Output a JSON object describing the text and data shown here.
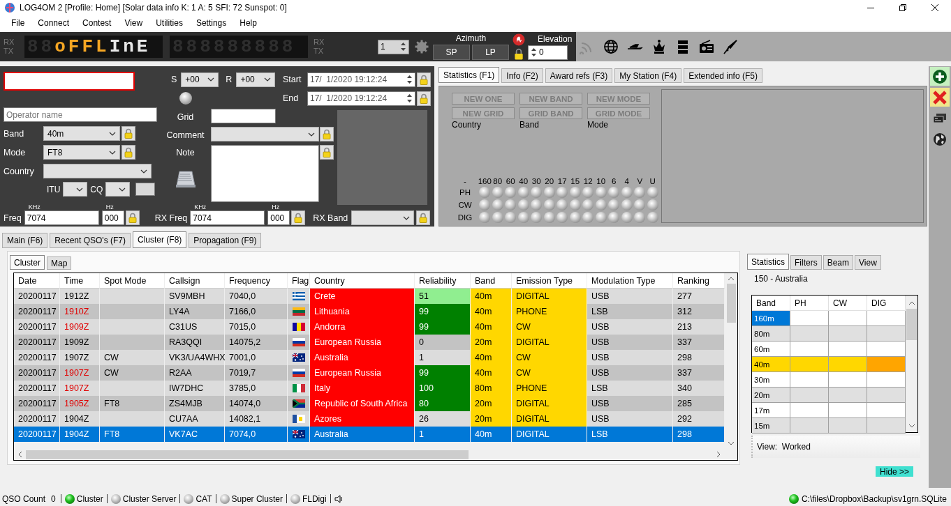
{
  "window": {
    "title": "LOG4OM 2 [Profile: Home] [Solar data info K: 1 A: 5 SFI: 72 Sunspot: 0]"
  },
  "menu": [
    "File",
    "Connect",
    "Contest",
    "View",
    "Utilities",
    "Settings",
    "Help"
  ],
  "toolbar": {
    "rx_tx_left": [
      "RX",
      "TX"
    ],
    "displays": [
      {
        "dim": "88",
        "segments": [
          {
            "text": "oFFL",
            "color": "#f5a623"
          },
          {
            "text": "InE",
            "color": "#e8e8e8"
          }
        ]
      },
      {
        "dim": "888888888"
      }
    ],
    "rx_tx_right": [
      "RX",
      "TX"
    ],
    "counter": "1",
    "azimuth": {
      "label": "Azimuth",
      "buttons": [
        "SP",
        "LP"
      ]
    },
    "elevation": {
      "label": "Elevation",
      "value": "0"
    }
  },
  "qso_form": {
    "callsign": {
      "highlighted": true
    },
    "operator": {
      "placeholder": "Operator name"
    },
    "band": {
      "label": "Band",
      "value": "40m"
    },
    "mode": {
      "label": "Mode",
      "value": "FT8"
    },
    "country": {
      "label": "Country"
    },
    "itu": {
      "label": "ITU"
    },
    "cq": {
      "label": "CQ"
    },
    "s": {
      "label": "S",
      "value": "+00"
    },
    "r": {
      "label": "R",
      "value": "+00"
    },
    "start": {
      "label": "Start",
      "value": "17/  1/2020 19:12:24"
    },
    "end": {
      "label": "End",
      "value": "17/  1/2020 19:12:24"
    },
    "grid": {
      "label": "Grid"
    },
    "comment": {
      "label": "Comment"
    },
    "note": {
      "label": "Note"
    },
    "freq": {
      "label": "Freq",
      "khz_label": "KHz",
      "khz": "7074",
      "hz_label": "Hz",
      "hz": "000"
    },
    "rx_freq": {
      "label": "RX Freq",
      "khz_label": "KHz",
      "khz": "7074",
      "hz_label": "Hz",
      "hz": "000"
    },
    "rx_band": {
      "label": "RX Band"
    }
  },
  "stats_panel": {
    "tabs": [
      {
        "label": "Statistics (F1)",
        "selected": true
      },
      {
        "label": "Info (F2)",
        "selected": false
      },
      {
        "label": "Award refs (F3)",
        "selected": false
      },
      {
        "label": "My Station (F4)",
        "selected": false
      },
      {
        "label": "Extended info (F5)",
        "selected": false
      }
    ],
    "flags": [
      {
        "label": "NEW ONE",
        "disabled": true
      },
      {
        "label": "NEW BAND",
        "disabled": true
      },
      {
        "label": "NEW MODE",
        "disabled": true
      },
      {
        "label": "NEW GRID",
        "disabled": true
      },
      {
        "label": "GRID BAND",
        "disabled": true
      },
      {
        "label": "GRID MODE",
        "disabled": true
      }
    ],
    "columns": [
      "Country",
      "Band",
      "Mode"
    ],
    "band_grid": {
      "corner": "-",
      "bands": [
        "160",
        "80",
        "60",
        "40",
        "30",
        "20",
        "17",
        "15",
        "12",
        "10",
        "6",
        "4",
        "V",
        "U"
      ],
      "modes": [
        "PH",
        "CW",
        "DIG"
      ]
    }
  },
  "main_tabs": [
    {
      "label": "Main (F6)",
      "selected": false
    },
    {
      "label": "Recent QSO's (F7)",
      "selected": false
    },
    {
      "label": "Cluster (F8)",
      "selected": true
    },
    {
      "label": "Propagation (F9)",
      "selected": false
    }
  ],
  "cluster": {
    "tabs": [
      {
        "label": "Cluster",
        "selected": true
      },
      {
        "label": "Map",
        "selected": false
      }
    ],
    "columns": [
      "Date",
      "Time",
      "Spot Mode",
      "Callsign",
      "Frequency",
      "Flag",
      "Country",
      "Reliability",
      "Band",
      "Emission Type",
      "Modulation Type",
      "Ranking"
    ],
    "rows": [
      {
        "date": "20200117",
        "time": "1912Z",
        "time_alert": false,
        "callsign": "SV9MBH",
        "frequency": "7040,0",
        "flag": {
          "kind": "greece"
        },
        "country": "Crete",
        "reliability": {
          "value": "51",
          "color": "#90ee90"
        },
        "band": "40m",
        "emission": "DIGITAL",
        "modulation": "USB",
        "ranking": "277",
        "selected": false
      },
      {
        "date": "20200117",
        "time": "1910Z",
        "time_alert": true,
        "callsign": "LY4A",
        "frequency": "7166,0",
        "flag": {
          "kind": "lithuania"
        },
        "country": "Lithuania",
        "reliability": {
          "value": "99",
          "color": "#008000"
        },
        "band": "40m",
        "emission": "PHONE",
        "modulation": "LSB",
        "ranking": "312",
        "selected": false
      },
      {
        "date": "20200117",
        "time": "1909Z",
        "time_alert": true,
        "callsign": "C31US",
        "frequency": "7015,0",
        "flag": {
          "kind": "andorra"
        },
        "country": "Andorra",
        "reliability": {
          "value": "99",
          "color": "#008000"
        },
        "band": "40m",
        "emission": "CW",
        "modulation": "USB",
        "ranking": "213",
        "selected": false
      },
      {
        "date": "20200117",
        "time": "1909Z",
        "time_alert": false,
        "callsign": "RA3QQI",
        "frequency": "14075,2",
        "flag": {
          "kind": "russia"
        },
        "country": "European Russia",
        "reliability": {
          "value": "0"
        },
        "band": "20m",
        "emission": "DIGITAL",
        "modulation": "USB",
        "ranking": "337",
        "selected": false
      },
      {
        "date": "20200117",
        "time": "1907Z",
        "time_alert": false,
        "spot_mode": "CW",
        "callsign": "VK3/UA4WHX",
        "frequency": "7001,0",
        "flag": {
          "kind": "australia"
        },
        "country": "Australia",
        "reliability": {
          "value": "1"
        },
        "band": "40m",
        "emission": "CW",
        "modulation": "USB",
        "ranking": "298",
        "selected": false
      },
      {
        "date": "20200117",
        "time": "1907Z",
        "time_alert": true,
        "spot_mode": "CW",
        "callsign": "R2AA",
        "frequency": "7019,7",
        "flag": {
          "kind": "russia"
        },
        "country": "European Russia",
        "reliability": {
          "value": "99",
          "color": "#008000"
        },
        "band": "40m",
        "emission": "CW",
        "modulation": "USB",
        "ranking": "337",
        "selected": false
      },
      {
        "date": "20200117",
        "time": "1907Z",
        "time_alert": true,
        "callsign": "IW7DHC",
        "frequency": "3785,0",
        "flag": {
          "kind": "italy"
        },
        "country": "Italy",
        "reliability": {
          "value": "100",
          "color": "#008000"
        },
        "band": "80m",
        "emission": "PHONE",
        "modulation": "LSB",
        "ranking": "340",
        "selected": false
      },
      {
        "date": "20200117",
        "time": "1905Z",
        "time_alert": true,
        "spot_mode": "FT8",
        "callsign": "ZS4MJB",
        "frequency": "14074,0",
        "flag": {
          "kind": "south-africa"
        },
        "country": "Republic of South Africa",
        "reliability": {
          "value": "80",
          "color": "#008000"
        },
        "band": "20m",
        "emission": "DIGITAL",
        "modulation": "USB",
        "ranking": "285",
        "selected": false
      },
      {
        "date": "20200117",
        "time": "1904Z",
        "time_alert": false,
        "callsign": "CU7AA",
        "frequency": "14082,1",
        "flag": {
          "kind": "azores"
        },
        "country": "Azores",
        "reliability": {
          "value": "26"
        },
        "band": "20m",
        "emission": "DIGITAL",
        "modulation": "USB",
        "ranking": "292",
        "selected": false
      },
      {
        "date": "20200117",
        "time": "1904Z",
        "spot_mode": "FT8",
        "callsign": "VK7AC",
        "frequency": "7074,0",
        "flag": {
          "kind": "australia"
        },
        "country": "Australia",
        "reliability": {
          "value": "1"
        },
        "band": "40m",
        "emission": "DIGITAL",
        "modulation": "LSB",
        "ranking": "298",
        "selected": true
      }
    ]
  },
  "band_stats": {
    "tabs": [
      {
        "label": "Statistics",
        "selected": true
      },
      {
        "label": "Filters",
        "selected": false
      },
      {
        "label": "Beam",
        "selected": false
      },
      {
        "label": "View",
        "selected": false
      }
    ],
    "entity": "150 - Australia",
    "columns": [
      "Band",
      "PH",
      "CW",
      "DIG"
    ],
    "rows": [
      {
        "band": "160m",
        "selected": true
      },
      {
        "band": "80m",
        "selected": false
      },
      {
        "band": "60m",
        "selected": false
      },
      {
        "band": "40m",
        "selected": false,
        "color": "#ffd700",
        "cells": [
          {
            "color": "#ffd700"
          },
          {
            "color": "#ffd700"
          },
          {
            "color": "#ffa500"
          }
        ]
      },
      {
        "band": "30m",
        "selected": false
      },
      {
        "band": "20m",
        "selected": false
      },
      {
        "band": "17m",
        "selected": false
      },
      {
        "band": "15m",
        "selected": false
      }
    ],
    "view": "View:  Worked",
    "hide_button": "Hide >>"
  },
  "status_bar": {
    "qso_label": "QSO Count",
    "qso_count": "0",
    "items": [
      {
        "label": "Cluster",
        "on": true
      },
      {
        "label": "Cluster Server",
        "on": false
      },
      {
        "label": "CAT",
        "on": false
      },
      {
        "label": "Super Cluster",
        "on": false
      },
      {
        "label": "FLDigi",
        "on": false
      }
    ],
    "database": {
      "path": "C:\\files\\Dropbox\\Backup\\sv1grn.SQLite",
      "on": true
    }
  }
}
